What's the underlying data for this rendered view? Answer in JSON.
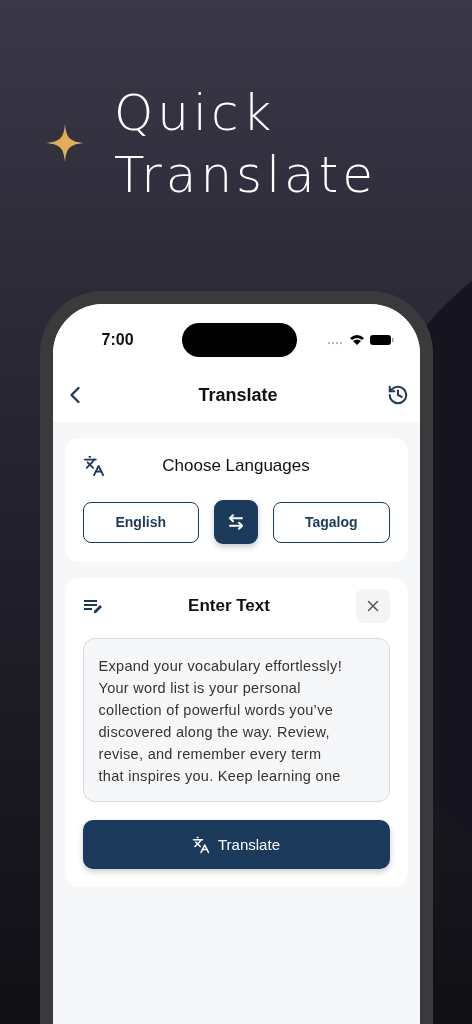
{
  "headline": [
    "Quick",
    "Translate"
  ],
  "status_bar": {
    "time": "7:00"
  },
  "nav": {
    "title": "Translate"
  },
  "languages": {
    "title": "Choose Languages",
    "source": "English",
    "target": "Tagalog"
  },
  "input": {
    "title": "Enter Text",
    "value": "Expand your vocabulary effortlessly!\nYour word list is your personal\ncollection of powerful words you’ve\ndiscovered along the way. Review,\nrevise, and remember every term\nthat inspires you. Keep learning one",
    "button": "Translate"
  }
}
